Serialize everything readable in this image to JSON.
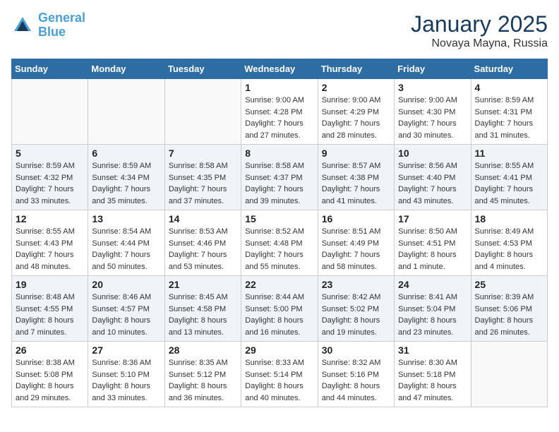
{
  "header": {
    "logo_line1": "General",
    "logo_line2": "Blue",
    "month": "January 2025",
    "location": "Novaya Mayna, Russia"
  },
  "weekdays": [
    "Sunday",
    "Monday",
    "Tuesday",
    "Wednesday",
    "Thursday",
    "Friday",
    "Saturday"
  ],
  "weeks": [
    [
      {
        "day": "",
        "info": ""
      },
      {
        "day": "",
        "info": ""
      },
      {
        "day": "",
        "info": ""
      },
      {
        "day": "1",
        "info": "Sunrise: 9:00 AM\nSunset: 4:28 PM\nDaylight: 7 hours\nand 27 minutes."
      },
      {
        "day": "2",
        "info": "Sunrise: 9:00 AM\nSunset: 4:29 PM\nDaylight: 7 hours\nand 28 minutes."
      },
      {
        "day": "3",
        "info": "Sunrise: 9:00 AM\nSunset: 4:30 PM\nDaylight: 7 hours\nand 30 minutes."
      },
      {
        "day": "4",
        "info": "Sunrise: 8:59 AM\nSunset: 4:31 PM\nDaylight: 7 hours\nand 31 minutes."
      }
    ],
    [
      {
        "day": "5",
        "info": "Sunrise: 8:59 AM\nSunset: 4:32 PM\nDaylight: 7 hours\nand 33 minutes."
      },
      {
        "day": "6",
        "info": "Sunrise: 8:59 AM\nSunset: 4:34 PM\nDaylight: 7 hours\nand 35 minutes."
      },
      {
        "day": "7",
        "info": "Sunrise: 8:58 AM\nSunset: 4:35 PM\nDaylight: 7 hours\nand 37 minutes."
      },
      {
        "day": "8",
        "info": "Sunrise: 8:58 AM\nSunset: 4:37 PM\nDaylight: 7 hours\nand 39 minutes."
      },
      {
        "day": "9",
        "info": "Sunrise: 8:57 AM\nSunset: 4:38 PM\nDaylight: 7 hours\nand 41 minutes."
      },
      {
        "day": "10",
        "info": "Sunrise: 8:56 AM\nSunset: 4:40 PM\nDaylight: 7 hours\nand 43 minutes."
      },
      {
        "day": "11",
        "info": "Sunrise: 8:55 AM\nSunset: 4:41 PM\nDaylight: 7 hours\nand 45 minutes."
      }
    ],
    [
      {
        "day": "12",
        "info": "Sunrise: 8:55 AM\nSunset: 4:43 PM\nDaylight: 7 hours\nand 48 minutes."
      },
      {
        "day": "13",
        "info": "Sunrise: 8:54 AM\nSunset: 4:44 PM\nDaylight: 7 hours\nand 50 minutes."
      },
      {
        "day": "14",
        "info": "Sunrise: 8:53 AM\nSunset: 4:46 PM\nDaylight: 7 hours\nand 53 minutes."
      },
      {
        "day": "15",
        "info": "Sunrise: 8:52 AM\nSunset: 4:48 PM\nDaylight: 7 hours\nand 55 minutes."
      },
      {
        "day": "16",
        "info": "Sunrise: 8:51 AM\nSunset: 4:49 PM\nDaylight: 7 hours\nand 58 minutes."
      },
      {
        "day": "17",
        "info": "Sunrise: 8:50 AM\nSunset: 4:51 PM\nDaylight: 8 hours\nand 1 minute."
      },
      {
        "day": "18",
        "info": "Sunrise: 8:49 AM\nSunset: 4:53 PM\nDaylight: 8 hours\nand 4 minutes."
      }
    ],
    [
      {
        "day": "19",
        "info": "Sunrise: 8:48 AM\nSunset: 4:55 PM\nDaylight: 8 hours\nand 7 minutes."
      },
      {
        "day": "20",
        "info": "Sunrise: 8:46 AM\nSunset: 4:57 PM\nDaylight: 8 hours\nand 10 minutes."
      },
      {
        "day": "21",
        "info": "Sunrise: 8:45 AM\nSunset: 4:58 PM\nDaylight: 8 hours\nand 13 minutes."
      },
      {
        "day": "22",
        "info": "Sunrise: 8:44 AM\nSunset: 5:00 PM\nDaylight: 8 hours\nand 16 minutes."
      },
      {
        "day": "23",
        "info": "Sunrise: 8:42 AM\nSunset: 5:02 PM\nDaylight: 8 hours\nand 19 minutes."
      },
      {
        "day": "24",
        "info": "Sunrise: 8:41 AM\nSunset: 5:04 PM\nDaylight: 8 hours\nand 23 minutes."
      },
      {
        "day": "25",
        "info": "Sunrise: 8:39 AM\nSunset: 5:06 PM\nDaylight: 8 hours\nand 26 minutes."
      }
    ],
    [
      {
        "day": "26",
        "info": "Sunrise: 8:38 AM\nSunset: 5:08 PM\nDaylight: 8 hours\nand 29 minutes."
      },
      {
        "day": "27",
        "info": "Sunrise: 8:36 AM\nSunset: 5:10 PM\nDaylight: 8 hours\nand 33 minutes."
      },
      {
        "day": "28",
        "info": "Sunrise: 8:35 AM\nSunset: 5:12 PM\nDaylight: 8 hours\nand 36 minutes."
      },
      {
        "day": "29",
        "info": "Sunrise: 8:33 AM\nSunset: 5:14 PM\nDaylight: 8 hours\nand 40 minutes."
      },
      {
        "day": "30",
        "info": "Sunrise: 8:32 AM\nSunset: 5:16 PM\nDaylight: 8 hours\nand 44 minutes."
      },
      {
        "day": "31",
        "info": "Sunrise: 8:30 AM\nSunset: 5:18 PM\nDaylight: 8 hours\nand 47 minutes."
      },
      {
        "day": "",
        "info": ""
      }
    ]
  ]
}
